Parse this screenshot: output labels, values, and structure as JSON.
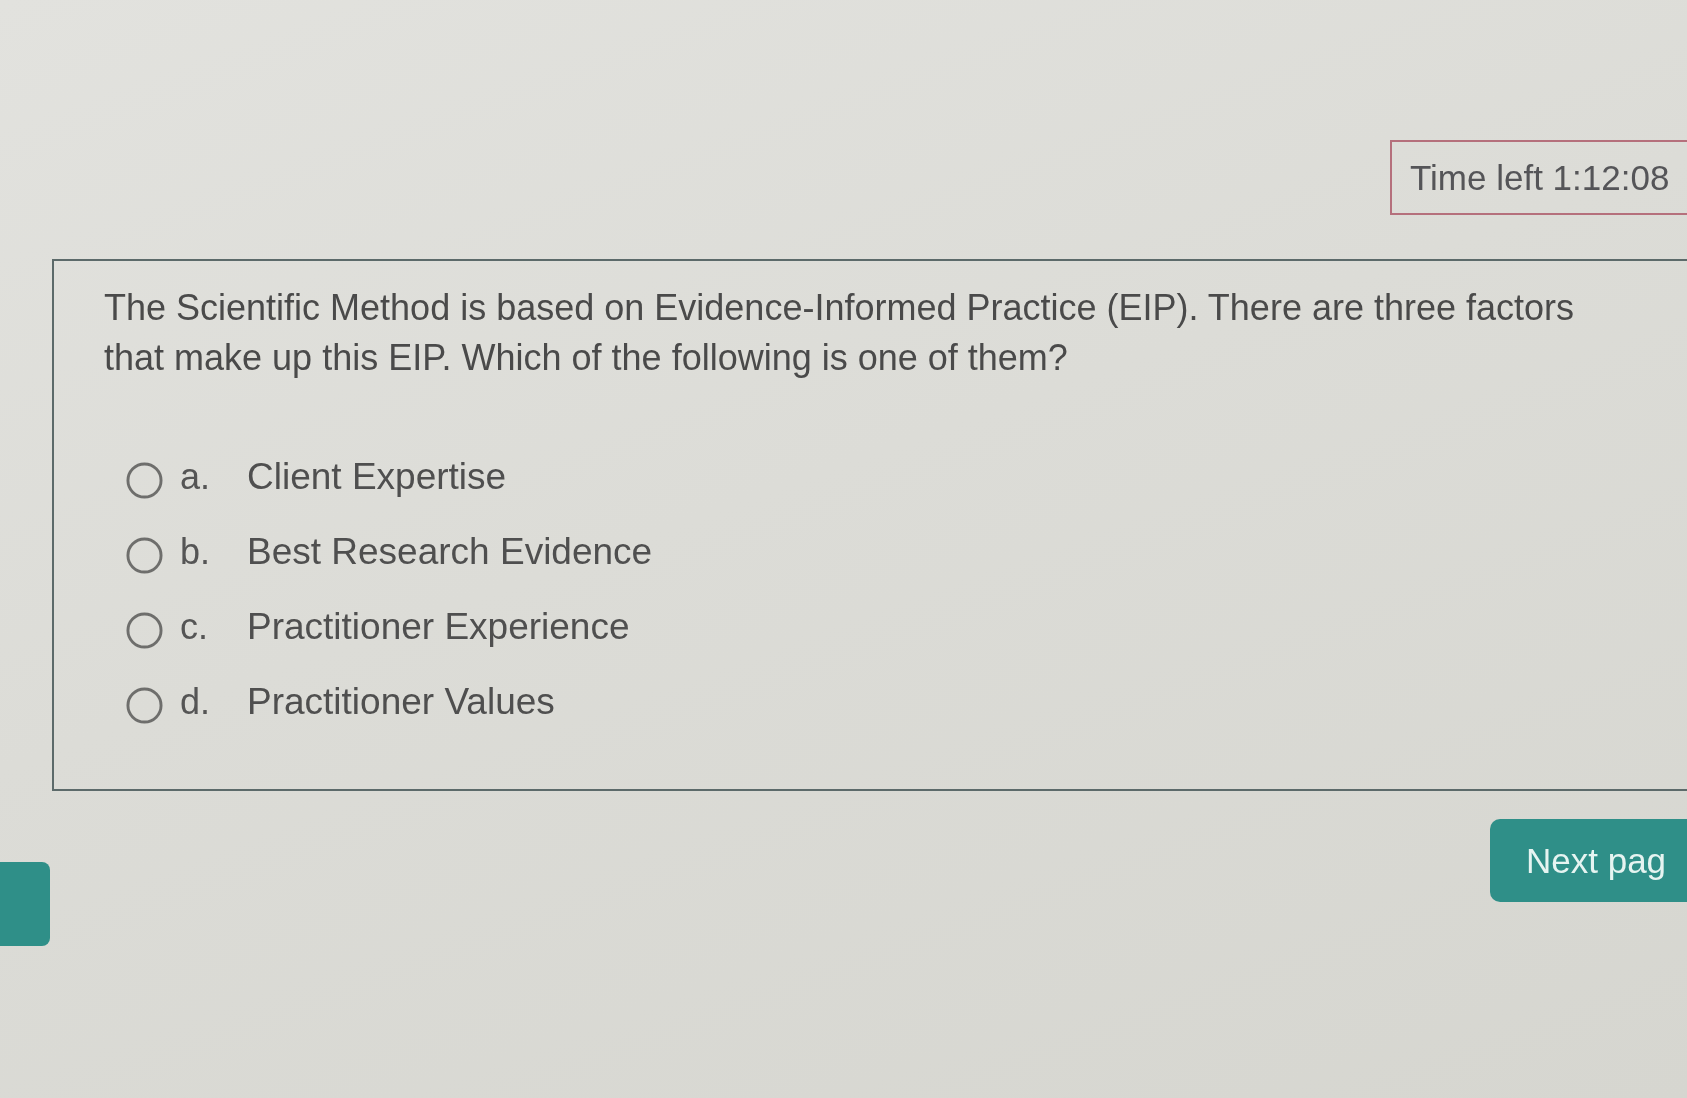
{
  "timer": {
    "label": "Time left 1:12:08"
  },
  "question": {
    "text": "The Scientific Method is based on Evidence-Informed Practice (EIP). There are three factors that make up this EIP. Which of the following is one of them?",
    "options": [
      {
        "letter": "a.",
        "text": "Client Expertise",
        "selected": false
      },
      {
        "letter": "b.",
        "text": "Best Research Evidence",
        "selected": false
      },
      {
        "letter": "c.",
        "text": "Practitioner Experience",
        "selected": false
      },
      {
        "letter": "d.",
        "text": "Practitioner Values",
        "selected": false
      }
    ]
  },
  "navigation": {
    "buttons": [
      {
        "kind": "stub"
      },
      {
        "kind": "labelled",
        "label": "Next pag"
      }
    ]
  }
}
